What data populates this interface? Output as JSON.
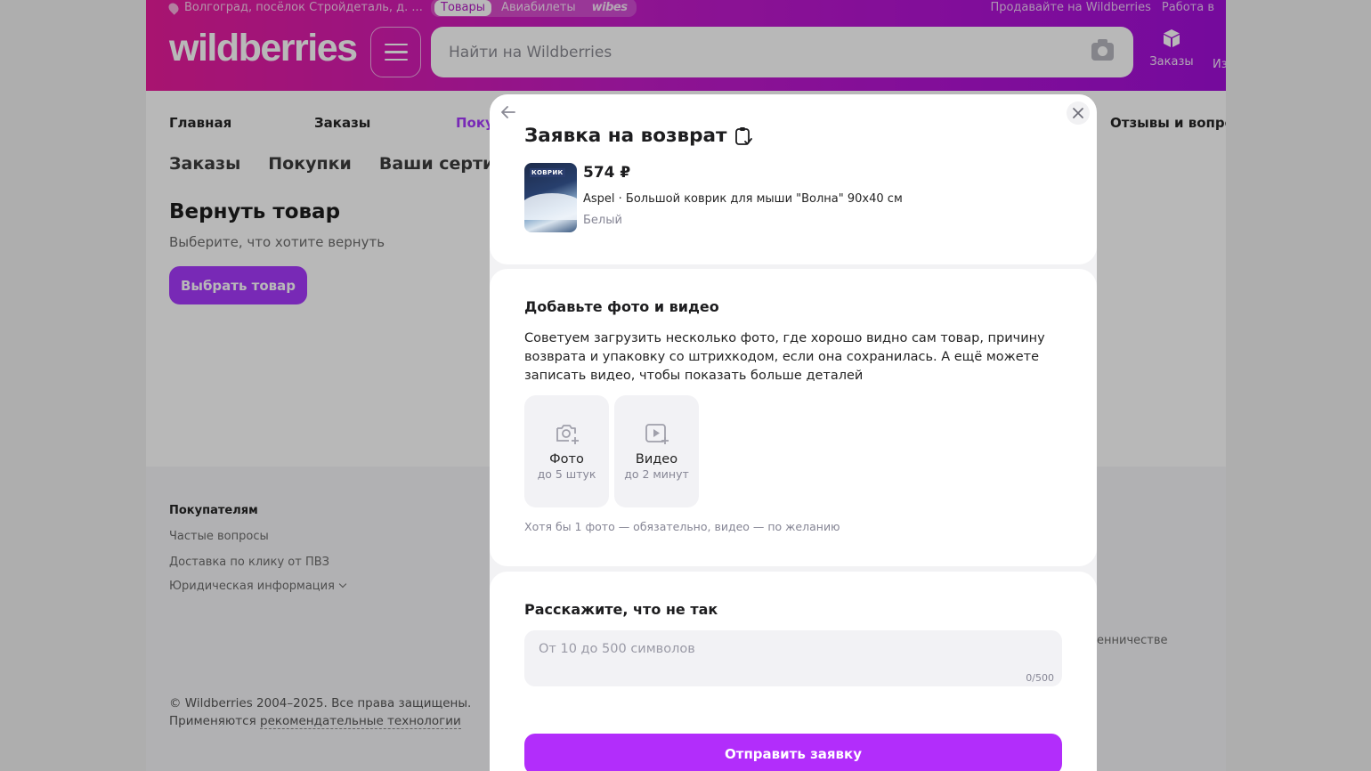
{
  "header": {
    "location": "Волгоград, посёлок Стройдеталь, д. ...",
    "top_tabs": [
      "Товары",
      "Авиабилеты",
      "wibes"
    ],
    "top_links": [
      "Продавайте на Wildberries",
      "Работа в"
    ],
    "logo": "wildberries",
    "search_placeholder": "Найти на Wildberries",
    "orders_label": "Заказы",
    "more_label": "Из"
  },
  "nav": {
    "items": [
      "Главная",
      "Заказы",
      "Покупки",
      "Отзывы и вопросы"
    ]
  },
  "subnav": [
    "Заказы",
    "Покупки",
    "Ваши сертифика"
  ],
  "main": {
    "title": "Вернуть товар",
    "subtitle": "Выберите, что хотите вернуть",
    "choose_button": "Выбрать товар"
  },
  "footer": {
    "heading": "Покупателям",
    "links": [
      "Частые вопросы",
      "Доставка по клику от ПВЗ",
      "Юридическая информация"
    ],
    "right_link": "енничестве",
    "copyright": "© Wildberries 2004–2025. Все права защищены.",
    "tech_prefix": "Применяются ",
    "tech_link": "рекомендательные технологии"
  },
  "modal": {
    "title": "Заявка на возврат",
    "product": {
      "price": "574 ₽",
      "name": "Aspel · Большой коврик для мыши \"Волна\" 90x40 см",
      "color": "Белый",
      "thumb_label": "КОВРИК"
    },
    "media": {
      "title": "Добавьте фото и видео",
      "text": "Советуем загрузить несколько фото, где хорошо видно сам товар, причину возврата и упаковку со штрихкодом, если она сохранилась. А ещё можете записать видео, чтобы показать больше деталей",
      "photo_label": "Фото",
      "photo_sub": "до 5 штук",
      "video_label": "Видео",
      "video_sub": "до 2 минут",
      "hint": "Хотя бы 1 фото — обязательно, видео — по желанию"
    },
    "reason": {
      "title": "Расскажите, что не так",
      "placeholder": "От 10 до 500 символов",
      "counter": "0/500"
    },
    "submit_label": "Отправить заявку"
  },
  "colors": {
    "brand_gradient_start": "#e91d9b",
    "brand_gradient_end": "#a20fd8",
    "accent": "#a73afd",
    "submit": "#b22dfb"
  }
}
